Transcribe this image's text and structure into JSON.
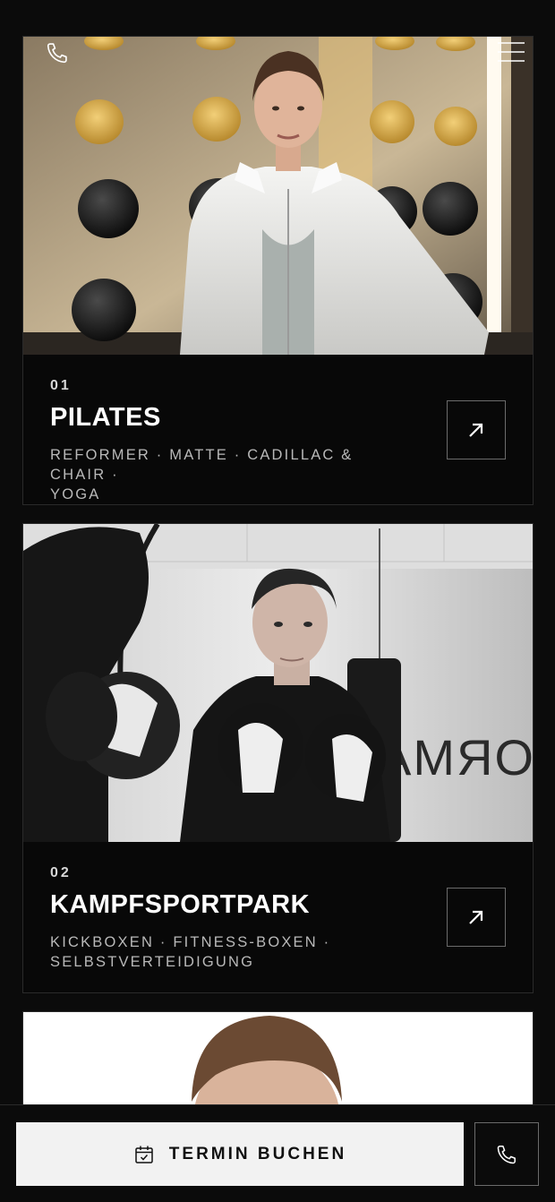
{
  "header": {
    "phone_icon": "phone-icon",
    "menu_icon": "menu-icon"
  },
  "cards": [
    {
      "number": "01",
      "title": "PILATES",
      "tags_line1": "REFORMER · MATTE · CADILLAC & CHAIR ·",
      "tags_line2": "YOGA",
      "arrow_icon": "arrow-up-right-icon"
    },
    {
      "number": "02",
      "title": "KAMPFSPORTPARK",
      "tags_line1": "KICKBOXEN · FITNESS-BOXEN ·",
      "tags_line2": "SELBSTVERTEIDIGUNG",
      "photo_sign_text": "ORMA",
      "arrow_icon": "arrow-up-right-icon"
    }
  ],
  "bottom_bar": {
    "book_label": "TERMIN BUCHEN",
    "calendar_icon": "calendar-check-icon",
    "call_icon": "phone-icon"
  },
  "colors": {
    "background": "#0b0b0b",
    "card_border": "#2a2a2a",
    "button_light": "#f2f2f2"
  }
}
